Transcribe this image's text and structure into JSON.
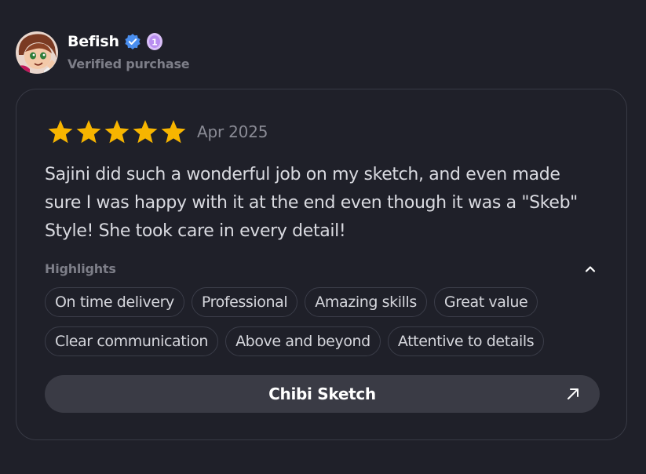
{
  "reviewer": {
    "name": "Befish",
    "subtitle": "Verified purchase",
    "avatar_icon": "avatar-illustration",
    "verified_icon": "verified-check-icon",
    "level_badge": "1"
  },
  "review": {
    "rating": 5,
    "max_rating": 5,
    "star_color": "#f7b500",
    "date": "Apr 2025",
    "text": "Sajini did such a wonderful job on my sketch, and even made sure I was happy with it at the end even though it was a \"Skeb\" Style! She took care in every detail!"
  },
  "highlights": {
    "label": "Highlights",
    "toggle_icon": "chevron-up-icon",
    "tags": [
      "On time delivery",
      "Professional",
      "Amazing skills",
      "Great value",
      "Clear communication",
      "Above and beyond",
      "Attentive to details"
    ]
  },
  "product": {
    "label": "Chibi Sketch",
    "icon": "arrow-up-right-icon"
  },
  "colors": {
    "background": "#1f2029",
    "card_border": "#383a45",
    "button_bg": "#3a3b45",
    "verified_blue": "#3b82f6",
    "badge_purple": "#c9a6f5"
  }
}
